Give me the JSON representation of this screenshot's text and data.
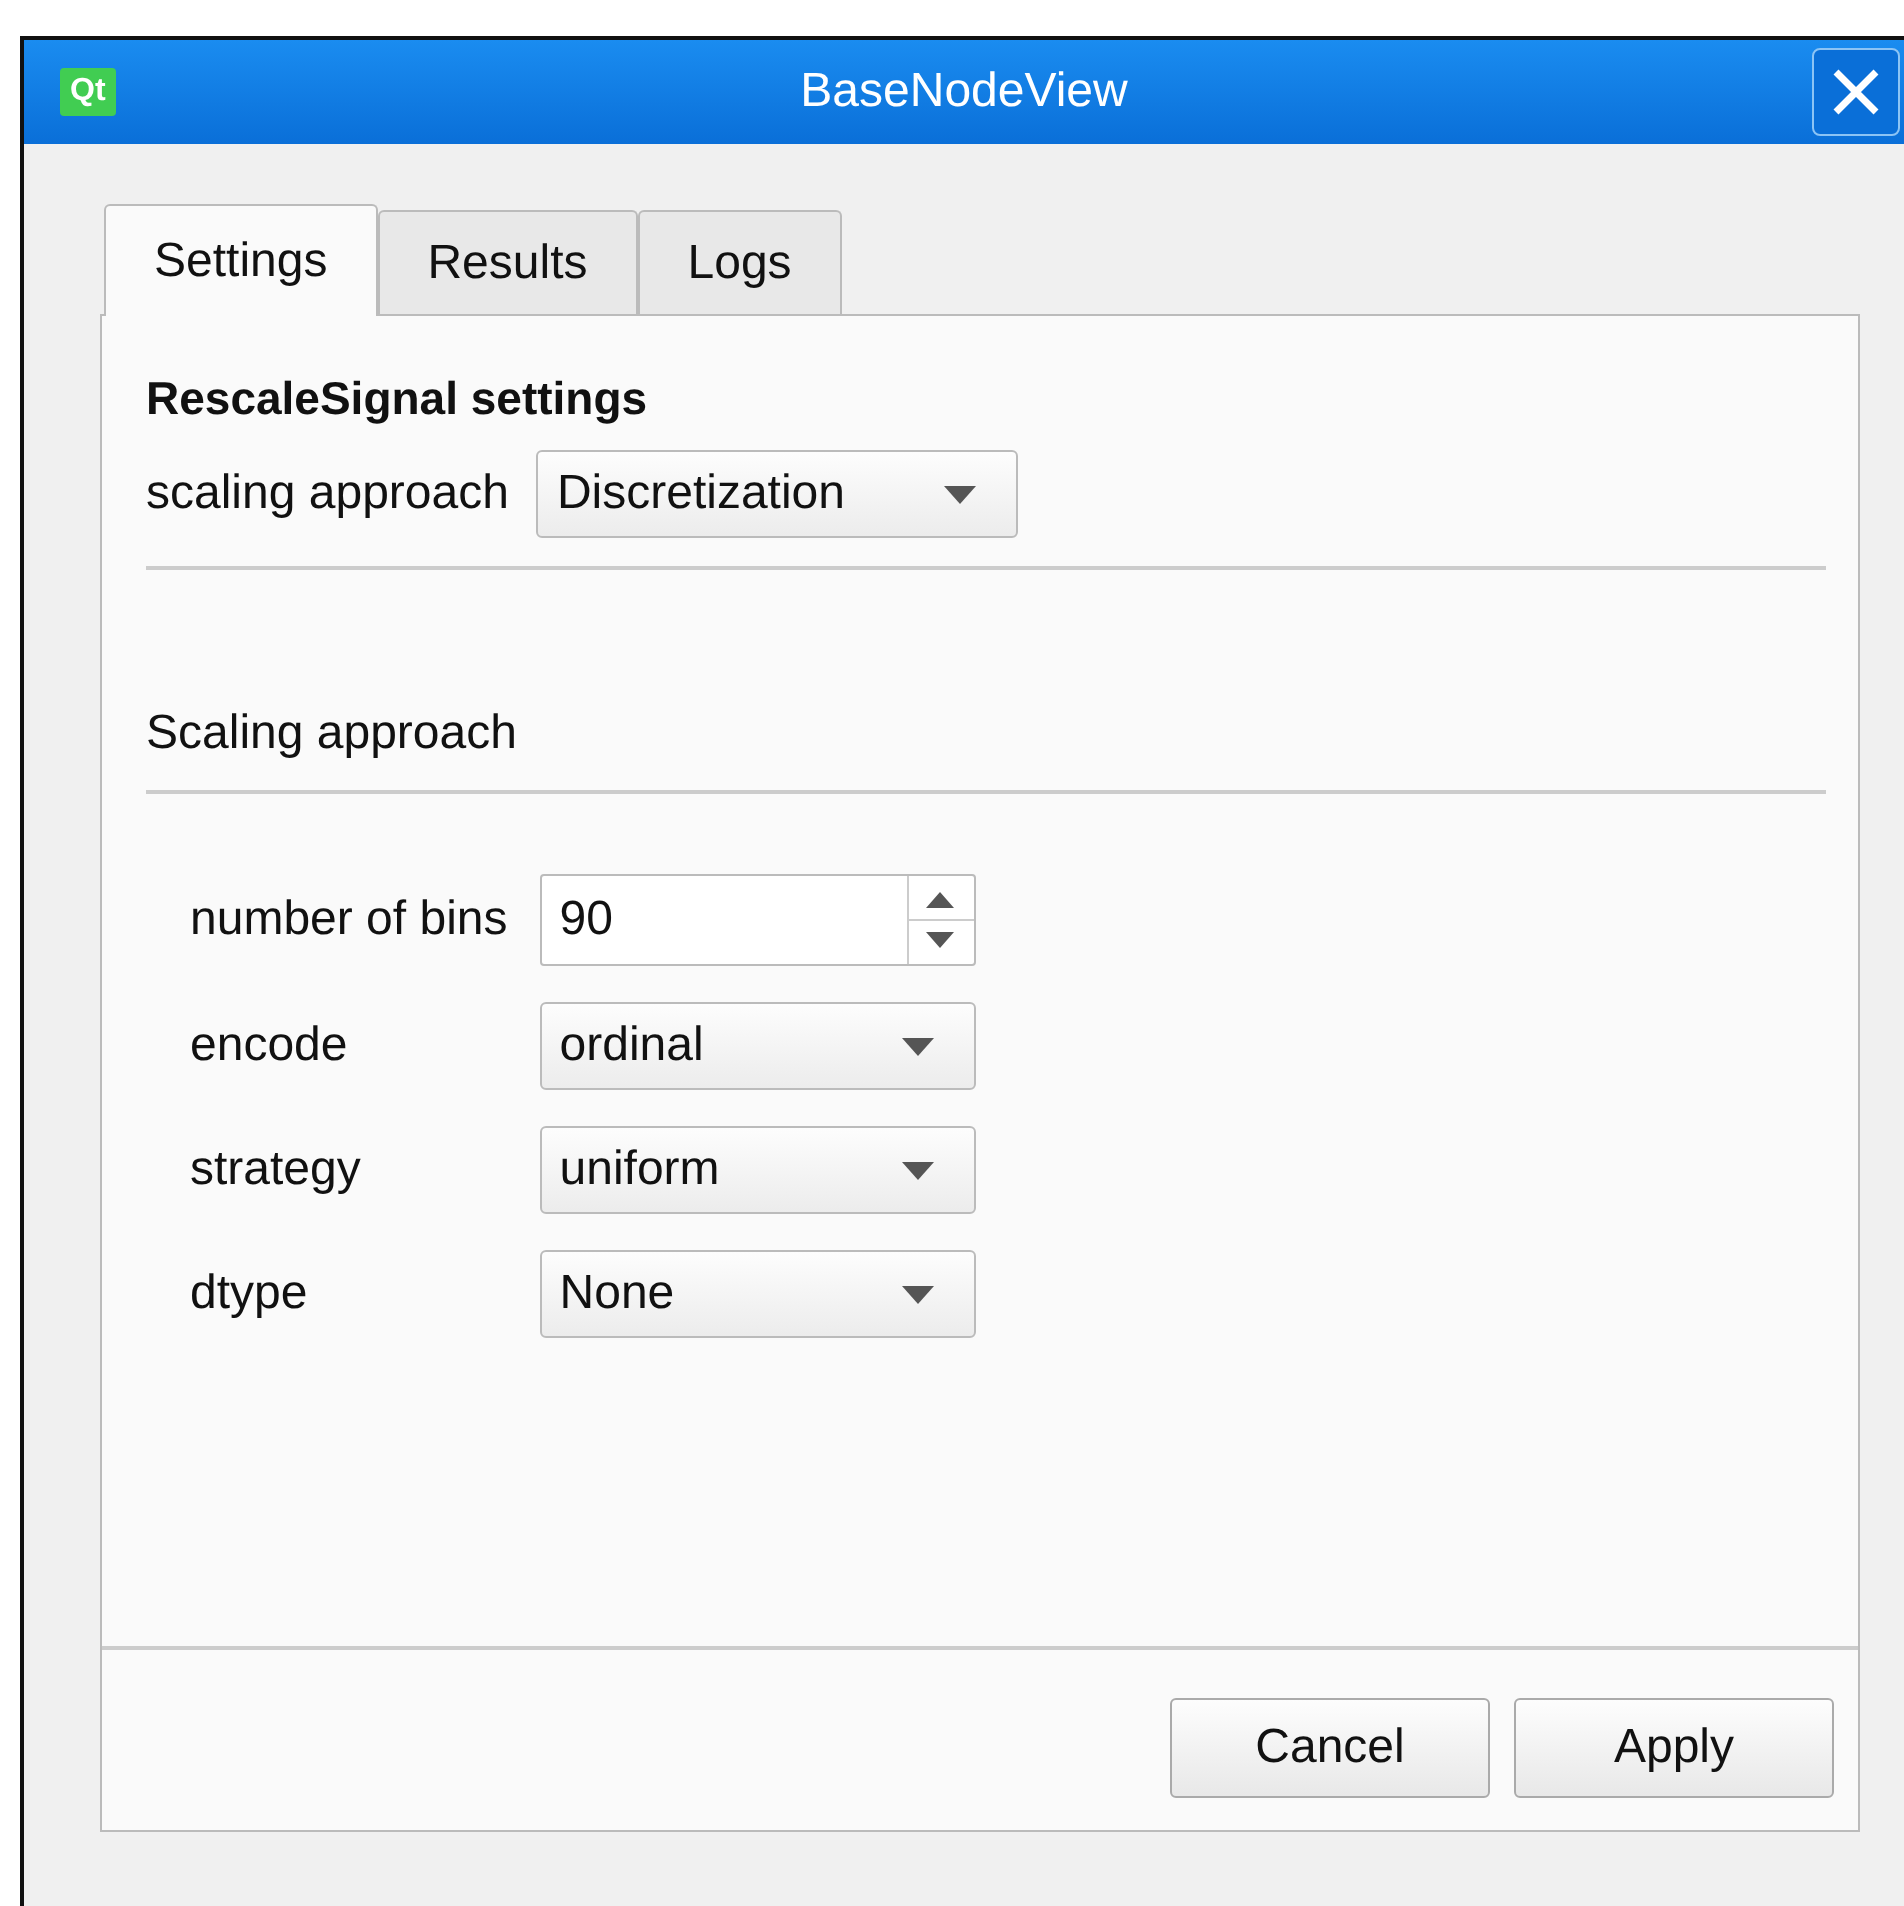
{
  "window": {
    "logo": "Qt",
    "title": "BaseNodeView"
  },
  "tabs": [
    {
      "label": "Settings",
      "selected": true
    },
    {
      "label": "Results",
      "selected": false
    },
    {
      "label": "Logs",
      "selected": false
    }
  ],
  "heading": "RescaleSignal settings",
  "approach": {
    "label": "scaling approach",
    "value": "Discretization"
  },
  "section": "Scaling approach",
  "params": [
    {
      "kind": "spinbox",
      "label": "number of bins",
      "value": "90"
    },
    {
      "kind": "combo",
      "label": "encode",
      "value": "ordinal"
    },
    {
      "kind": "combo",
      "label": "strategy",
      "value": "uniform"
    },
    {
      "kind": "combo",
      "label": "dtype",
      "value": "None"
    }
  ],
  "buttons": [
    "Cancel",
    "Apply"
  ]
}
